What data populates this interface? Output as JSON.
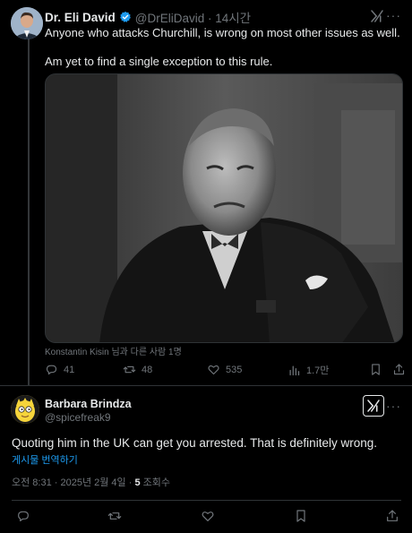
{
  "tweet": {
    "author_name": "Dr. Eli David",
    "handle_time": "@DrEliDavid · 14시간",
    "body_line1": "Anyone who attacks Churchill, is wrong on most other issues as well.",
    "body_line2": "Am yet to find a single exception to this rule.",
    "tagged_text": "Konstantin Kisin 님과 다른 사람 1명",
    "stats": {
      "replies": "41",
      "reposts": "48",
      "likes": "535",
      "views": "1.7만"
    }
  },
  "reply": {
    "author_name": "Barbara Brindza",
    "handle": "@spicefreak9",
    "body": "Quoting him in the UK can get you arrested. That is definitely wrong.",
    "translate_link": "게시물 번역하기",
    "timestamp": "오전 8:31 · 2025년 2월 4일 · ",
    "views_count": "5",
    "views_label": " 조회수"
  },
  "icons": {
    "verified": "verified-badge-icon",
    "grok": "grok-icon",
    "more": "more-icon",
    "reply": "reply-icon",
    "repost": "repost-icon",
    "like": "like-icon",
    "views": "views-icon",
    "bookmark": "bookmark-icon",
    "share": "share-icon"
  },
  "colors": {
    "background": "#000000",
    "text": "#e7e9ea",
    "muted": "#71767b",
    "accent": "#1d9bf0",
    "border": "#2f3336"
  }
}
